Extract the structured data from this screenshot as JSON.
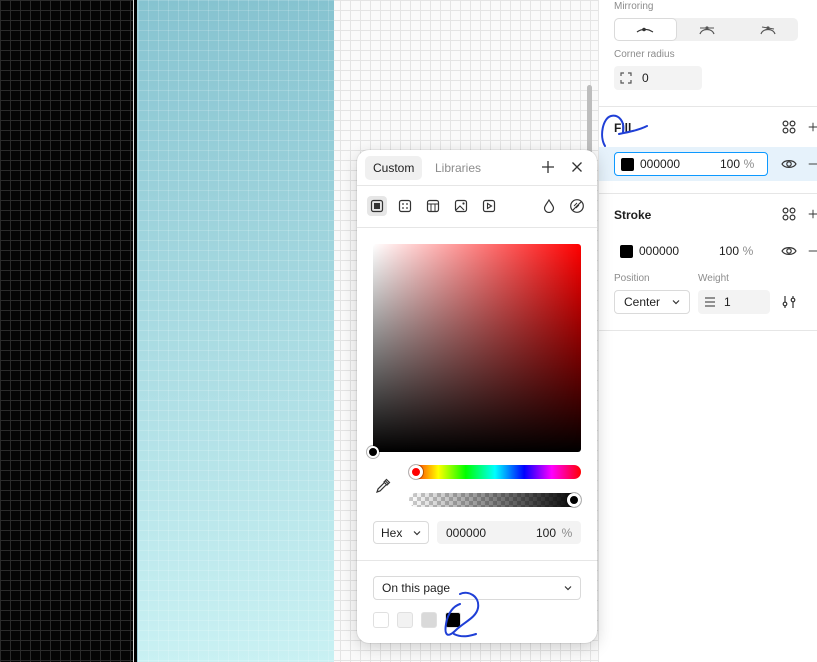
{
  "panel": {
    "mirroring": {
      "label": "Mirroring",
      "options": [
        {
          "icon": "mirroring-none-icon"
        },
        {
          "icon": "mirroring-angle-icon"
        },
        {
          "icon": "mirroring-angle-length-icon"
        }
      ],
      "active_index": 0
    },
    "corner_radius": {
      "label": "Corner radius",
      "value": "0",
      "icon": "corner-radius-icon"
    },
    "fill": {
      "title": "Fill",
      "swatch_color": "#000000",
      "hex": "000000",
      "opacity": "100",
      "percent": "%"
    },
    "stroke": {
      "title": "Stroke",
      "swatch_color": "#000000",
      "hex": "000000",
      "opacity": "100",
      "percent": "%",
      "position_label": "Position",
      "position_value": "Center",
      "weight_label": "Weight",
      "weight_value": "1"
    }
  },
  "picker": {
    "tabs": [
      "Custom",
      "Libraries"
    ],
    "active_tab": "Custom",
    "paint_types": [
      "solid-fill-icon",
      "gradient-icon",
      "pattern-icon",
      "image-icon",
      "video-icon"
    ],
    "blend_icon": "blend-mode-icon",
    "no_fill_icon": "no-fill-icon",
    "hue_color": "#ff0000",
    "alpha_percent": 100,
    "format": "Hex",
    "hex": "000000",
    "opacity": "100",
    "percent": "%",
    "source": "On this page",
    "document_colors": [
      "#ffffff",
      "#f2f2f2",
      "#d9d9d9",
      "#000000"
    ]
  },
  "colors": {
    "accent": "#0d99ff",
    "annotation": "#1f3fd6"
  }
}
